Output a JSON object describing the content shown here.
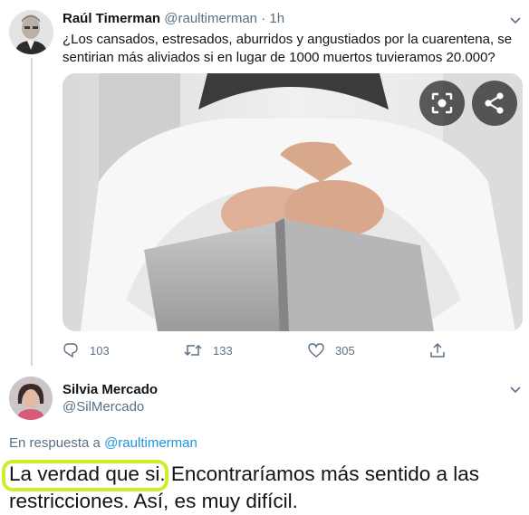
{
  "tweet": {
    "author_name": "Raúl Timerman",
    "author_handle": "@raultimerman",
    "separator": "·",
    "time": "1h",
    "text": "¿Los cansados, estresados, aburridos y angustiados por la cuarentena, se sentirian más aliviados si en lugar de 1000 muertos tuvieramos 20.000?",
    "media_icons": [
      "lens-icon",
      "share-icon"
    ],
    "stats": {
      "replies": "103",
      "retweets": "133",
      "likes": "305"
    }
  },
  "reply": {
    "author_name": "Silvia Mercado",
    "author_handle": "@SilMercado",
    "replying_label": "En respuesta a",
    "replying_to": "@raultimerman",
    "text": "La verdad que si. Encontraríamos más sentido a las restricciones. Así, es muy difícil.",
    "highlight_color": "#ccef2a"
  },
  "colors": {
    "secondary_text": "#5b7083",
    "link": "#1b95e0",
    "thread_line": "#cfd9de"
  }
}
